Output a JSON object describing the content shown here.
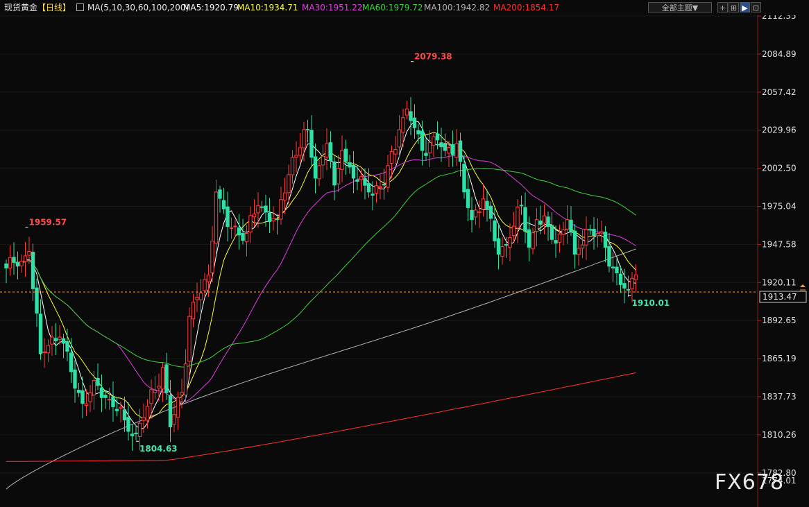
{
  "header": {
    "instrument": "现货黄金",
    "period": "【日线】",
    "ma_params": "MA(5,10,30,60,100,200)",
    "ma5": "MA5:1920.79",
    "ma10": "MA10:1934.71",
    "ma30": "MA30:1951.22",
    "ma60": "MA60:1979.72",
    "ma100": "MA100:1942.82",
    "ma200": "MA200:1854.17",
    "theme_button": "全部主题▼"
  },
  "price_axis_labels": [
    "2112.35",
    "2084.89",
    "2057.42",
    "2029.96",
    "2002.50",
    "1975.04",
    "1947.58",
    "1920.11",
    "1892.65",
    "1865.19",
    "1837.73",
    "1810.26",
    "1782.80",
    "1774.01"
  ],
  "current_price_label": "1913.47",
  "watermark": "FX678",
  "colors": {
    "up": "#ff3b3b",
    "down": "#2fe0a8",
    "ma5": "#ffffff",
    "ma10": "#ffff3a",
    "ma30": "#e040e0",
    "ma60": "#3cd23c",
    "ma100": "#b4b4b4",
    "ma200": "#ff3030",
    "axis": "#b02020"
  },
  "chart_data": {
    "type": "candlestick",
    "instrument": "现货黄金",
    "period": "日线",
    "y_range": [
      1770,
      2120
    ],
    "annotations": [
      {
        "label": "2079.38",
        "index": 106,
        "kind": "high"
      },
      {
        "label": "1959.57",
        "index": 5,
        "kind": "high"
      },
      {
        "label": "1804.63",
        "index": 34,
        "kind": "low"
      },
      {
        "label": "1910.01",
        "index": 163,
        "kind": "low"
      }
    ],
    "current_price": 1913.47,
    "anchors": [
      [
        0,
        1930
      ],
      [
        4,
        1935
      ],
      [
        6,
        1942
      ],
      [
        7,
        1915
      ],
      [
        9,
        1868
      ],
      [
        12,
        1880
      ],
      [
        14,
        1880
      ],
      [
        17,
        1855
      ],
      [
        20,
        1832
      ],
      [
        24,
        1845
      ],
      [
        27,
        1835
      ],
      [
        31,
        1820
      ],
      [
        34,
        1810
      ],
      [
        37,
        1830
      ],
      [
        41,
        1858
      ],
      [
        43,
        1815
      ],
      [
        46,
        1840
      ],
      [
        48,
        1895
      ],
      [
        53,
        1925
      ],
      [
        55,
        1985
      ],
      [
        58,
        1960
      ],
      [
        63,
        1955
      ],
      [
        66,
        1975
      ],
      [
        71,
        1965
      ],
      [
        75,
        2010
      ],
      [
        79,
        2030
      ],
      [
        81,
        1995
      ],
      [
        84,
        2020
      ],
      [
        86,
        1990
      ],
      [
        88,
        2015
      ],
      [
        91,
        1995
      ],
      [
        95,
        1985
      ],
      [
        99,
        1990
      ],
      [
        103,
        2030
      ],
      [
        105,
        2045
      ],
      [
        109,
        2015
      ],
      [
        112,
        2025
      ],
      [
        115,
        2015
      ],
      [
        118,
        2020
      ],
      [
        120,
        1985
      ],
      [
        122,
        1965
      ],
      [
        125,
        1980
      ],
      [
        129,
        1940
      ],
      [
        132,
        1952
      ],
      [
        135,
        1975
      ],
      [
        137,
        1945
      ],
      [
        139,
        1965
      ],
      [
        142,
        1960
      ],
      [
        144,
        1948
      ],
      [
        147,
        1965
      ],
      [
        149,
        1940
      ],
      [
        152,
        1958
      ],
      [
        155,
        1955
      ],
      [
        157,
        1945
      ],
      [
        159,
        1930
      ],
      [
        161,
        1918
      ],
      [
        163,
        1914
      ],
      [
        165,
        1925
      ]
    ]
  }
}
